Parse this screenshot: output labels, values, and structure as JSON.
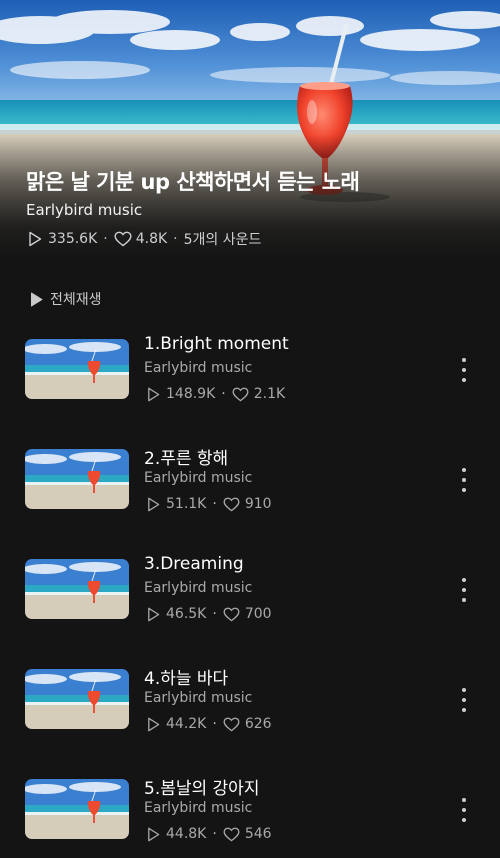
{
  "playlist": {
    "title": "맑은 날 기분 up 산책하면서 듣는 노래",
    "artist": "Earlybird music",
    "plays": "335.6K",
    "likes": "4.8K",
    "sound_count": "5개의 사운드",
    "separator": "·"
  },
  "play_all_label": "전체재생",
  "tracks": [
    {
      "title": "1.Bright moment",
      "artist": "Earlybird music",
      "plays": "148.9K",
      "likes": "2.1K"
    },
    {
      "title": "2.푸른 항해",
      "artist": "Earlybird music",
      "plays": "51.1K",
      "likes": "910"
    },
    {
      "title": "3.Dreaming",
      "artist": "Earlybird music",
      "plays": "46.5K",
      "likes": "700"
    },
    {
      "title": "4.하늘 바다",
      "artist": "Earlybird music",
      "plays": "44.2K",
      "likes": "626"
    },
    {
      "title": "5.봄날의 강아지",
      "artist": "Earlybird music",
      "plays": "44.8K",
      "likes": "546"
    }
  ],
  "icons": {
    "play": "play-icon",
    "heart": "heart-icon",
    "more": "more-vertical-icon"
  },
  "colors": {
    "background": "#141414",
    "text_primary": "#ffffff",
    "text_secondary": "#a9a9a9"
  }
}
